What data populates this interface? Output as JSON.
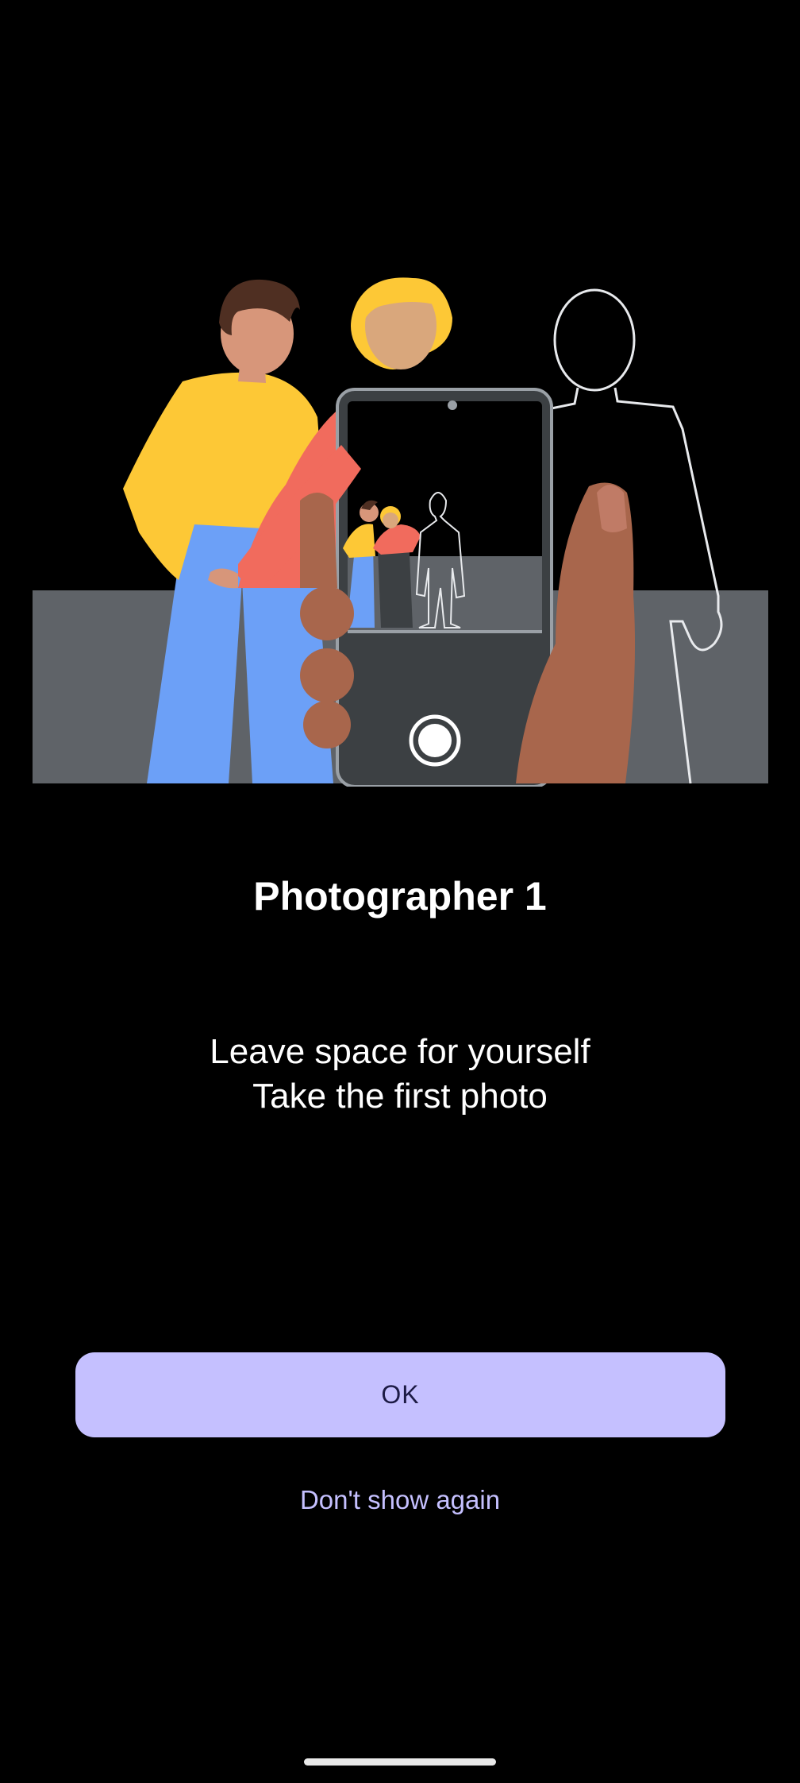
{
  "dialog": {
    "title": "Photographer 1",
    "description_lines": [
      "Leave space for yourself",
      "Take the first photo"
    ],
    "ok_label": "OK",
    "dont_show_label": "Don't show again"
  },
  "colors": {
    "background": "#000000",
    "primary_button": "#c5c0ff",
    "primary_button_text": "#1d1b45",
    "link_text": "#c5c0ff",
    "illustration_floor": "#5f6368"
  },
  "illustration": {
    "subject": "two people posing next to an outlined empty spot, a hand holding a phone in front"
  }
}
